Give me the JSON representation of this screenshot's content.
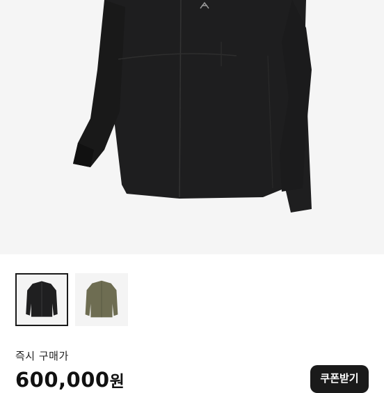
{
  "product": {
    "image_icon": "jacket-photo",
    "thumbnails": [
      {
        "color_name": "black",
        "color": "#1f1f20",
        "selected": true
      },
      {
        "color_name": "olive",
        "color": "#6e6d52",
        "selected": false
      }
    ]
  },
  "purchase": {
    "label": "즉시 구매가",
    "price": "600,000",
    "currency": "원",
    "coupon_button": "쿠폰받기"
  },
  "colors": {
    "accent": "#1a1a1a",
    "background": "#f5f5f5"
  }
}
